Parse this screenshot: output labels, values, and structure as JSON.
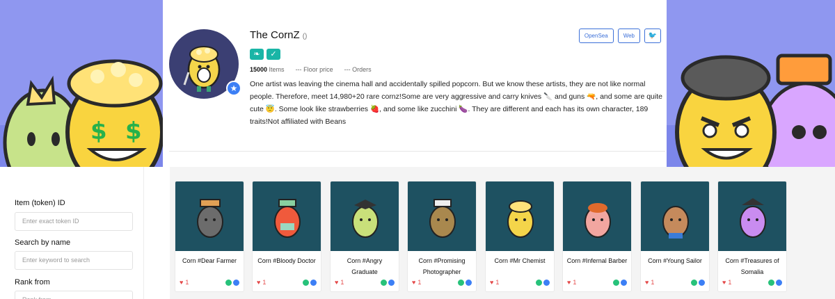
{
  "profile": {
    "title": "The CornZ",
    "title_suffix": "()",
    "items_count": "15000",
    "items_label": "Items",
    "floor_value": "---",
    "floor_label": "Floor price",
    "orders_value": "---",
    "orders_label": "Orders",
    "description": "One artist was leaving the cinema hall and accidentally spilled popcorn. But we know these artists, they are not like normal people. Therefore, meet 14,980+20 rare cornz!Some are very aggressive and carry knives 🔪 and guns 🔫, and some are quite cute 😇. Some look like strawberries 🍓, and some like zucchini 🍆. They are different and each has its own character, 189 traits!Not affiliated with Beans"
  },
  "links": {
    "opensea": "OpenSea",
    "web": "Web",
    "twitter_icon": "twitter-icon"
  },
  "filters": {
    "token_label": "Item (token) ID",
    "token_placeholder": "Enter exact token ID",
    "name_label": "Search by name",
    "name_placeholder": "Enter keyword to search",
    "rank_label": "Rank from",
    "rank_placeholder": "Rank from"
  },
  "cards": [
    {
      "name": "Corn #Dear Farmer",
      "likes": "1"
    },
    {
      "name": "Corn #Bloody Doctor",
      "likes": "1"
    },
    {
      "name": "Corn #Angry Graduate",
      "likes": "1"
    },
    {
      "name": "Corn #Promising Photographer",
      "likes": "1"
    },
    {
      "name": "Corn #Mr Chemist",
      "likes": "1"
    },
    {
      "name": "Corn #Infernal Barber",
      "likes": "1"
    },
    {
      "name": "Corn #Young Sailor",
      "likes": "1"
    },
    {
      "name": "Corn #Treasures of Somalia",
      "likes": "1"
    }
  ],
  "colors": {
    "banner": "#8f97f0",
    "accent": "#3b6fd8",
    "card_bg": "#1e5161",
    "like": "#e44a4a"
  }
}
